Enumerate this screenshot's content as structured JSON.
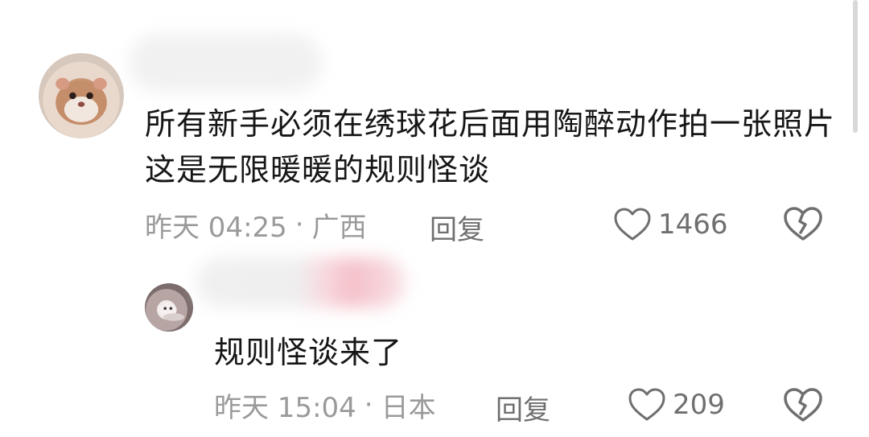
{
  "comments": [
    {
      "text": "所有新手必须在绣球花后面用陶醉动作拍一张照片 这是无限暖暖的规则怪谈",
      "time": "昨天 04:25",
      "separator": "·",
      "location": "广西",
      "reply_label": "回复",
      "likes": "1466",
      "avatar_icon": "hamster-avatar",
      "name_hidden": true
    },
    {
      "text": "规则怪谈来了",
      "time": "昨天 15:04",
      "separator": "·",
      "location": "日本",
      "reply_label": "回复",
      "likes": "209",
      "avatar_icon": "cat-avatar",
      "name_hidden": true
    }
  ],
  "icons": {
    "like": "heart-outline-icon",
    "dislike": "broken-heart-icon"
  },
  "colors": {
    "text": "#161616",
    "meta": "#9a9a9a",
    "action": "#6f6f6f"
  }
}
